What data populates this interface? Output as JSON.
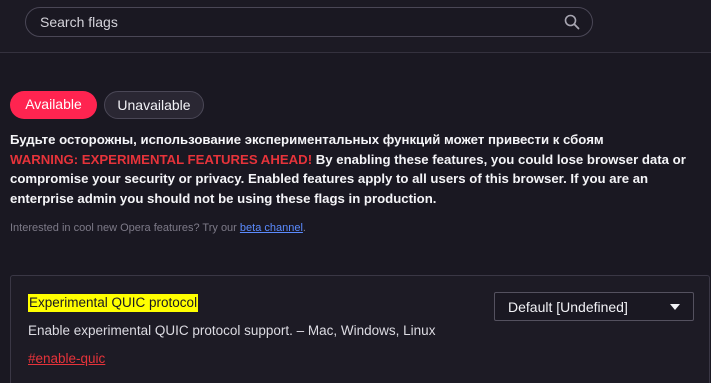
{
  "search": {
    "placeholder": "Search flags",
    "icon": "search-icon"
  },
  "tabs": [
    {
      "label": "Available",
      "active": true,
      "color": "#ff2450"
    },
    {
      "label": "Unavailable",
      "active": false
    }
  ],
  "warning": {
    "line_ru": "Будьте осторожны, использование экспериментальных функций может привести к сбоям",
    "headline": "WARNING: EXPERIMENTAL FEATURES AHEAD!",
    "body": " By enabling these features, you could lose browser data or compromise your security or privacy. Enabled features apply to all users of this browser. If you are an enterprise admin you should not be using these flags in production.",
    "headline_color": "#e6333a"
  },
  "interest": {
    "text": "Interested in cool new Opera features? Try our ",
    "link": "beta channel",
    "suffix": "."
  },
  "flags": [
    {
      "title": "Experimental QUIC protocol",
      "description": "Enable experimental QUIC protocol support. – Mac, Windows, Linux",
      "anchor": "#enable-quic",
      "selected_option": "Default [Undefined]"
    }
  ]
}
